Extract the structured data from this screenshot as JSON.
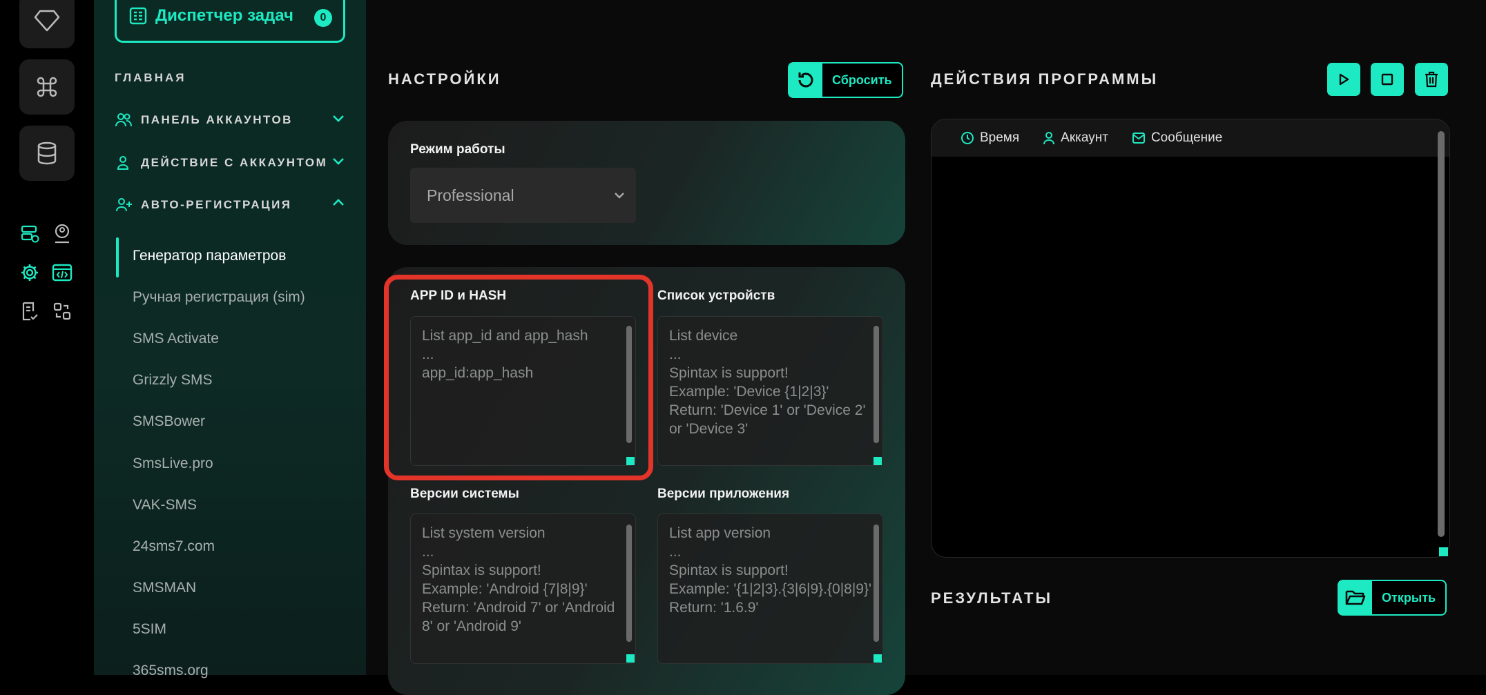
{
  "task_manager": {
    "label": "Диспетчер задач",
    "count": "0"
  },
  "sidebar": {
    "section_main": "ГЛАВНАЯ",
    "groups": [
      {
        "label": "ПАНЕЛЬ АККАУНТОВ"
      },
      {
        "label": "ДЕЙСТВИЕ С АККАУНТОМ"
      },
      {
        "label": "АВТО-РЕГИСТРАЦИЯ"
      }
    ],
    "items": [
      {
        "label": "Генератор параметров"
      },
      {
        "label": "Ручная регистрация (sim)"
      },
      {
        "label": "SMS Activate"
      },
      {
        "label": "Grizzly SMS"
      },
      {
        "label": "SMSBower"
      },
      {
        "label": "SmsLive.pro"
      },
      {
        "label": "VAK-SMS"
      },
      {
        "label": "24sms7.com"
      },
      {
        "label": "SMSMAN"
      },
      {
        "label": "5SIM"
      },
      {
        "label": "365sms.org"
      }
    ]
  },
  "settings": {
    "title": "НАСТРОЙКИ",
    "reset_label": "Сбросить",
    "mode_label": "Режим работы",
    "mode_value": "Professional",
    "fields": [
      {
        "label": "APP ID и HASH",
        "placeholder": "List app_id and app_hash\n...\napp_id:app_hash"
      },
      {
        "label": "Список устройств",
        "placeholder": "List device\n...\nSpintax is support!\nExample: 'Device {1|2|3}'\nReturn: 'Device 1' or 'Device 2' or 'Device 3'"
      },
      {
        "label": "Версии системы",
        "placeholder": "List system version\n...\nSpintax is support!\nExample: 'Android {7|8|9}'\nReturn: 'Android 7' or 'Android 8' or 'Android 9'"
      },
      {
        "label": "Версии приложения",
        "placeholder": "List app version\n...\nSpintax is support!\nExample: '{1|2|3}.{3|6|9}.{0|8|9}'\nReturn: '1.6.9'"
      }
    ]
  },
  "actions": {
    "title": "ДЕЙСТВИЯ ПРОГРАММЫ",
    "columns": [
      "Время",
      "Аккаунт",
      "Сообщение"
    ]
  },
  "results": {
    "title": "РЕЗУЛЬТАТЫ",
    "open_label": "Открыть"
  },
  "colors": {
    "accent": "#1de9c2",
    "highlight": "#e3342a",
    "sidebar_bg": "#0b2a23"
  }
}
